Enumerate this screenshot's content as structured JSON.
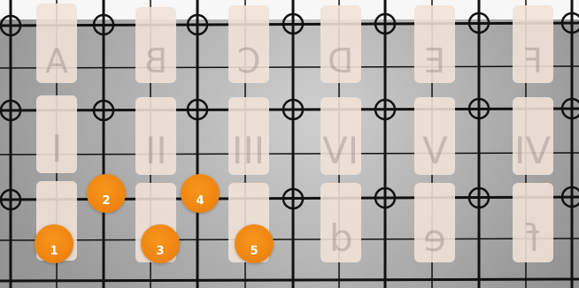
{
  "board": {
    "top_row": [
      "A",
      "B",
      "C",
      "D",
      "E",
      "F"
    ],
    "middle_row": [
      "I",
      "II",
      "III",
      "IV",
      "V",
      "VI"
    ],
    "bottom_row": [
      "",
      "",
      "",
      "d",
      "e",
      "f"
    ]
  },
  "markers": [
    "1",
    "2",
    "3",
    "4",
    "5"
  ],
  "colors": {
    "marker": "#ef8612",
    "tile": "#f0e2d8",
    "grid": "#111111"
  }
}
